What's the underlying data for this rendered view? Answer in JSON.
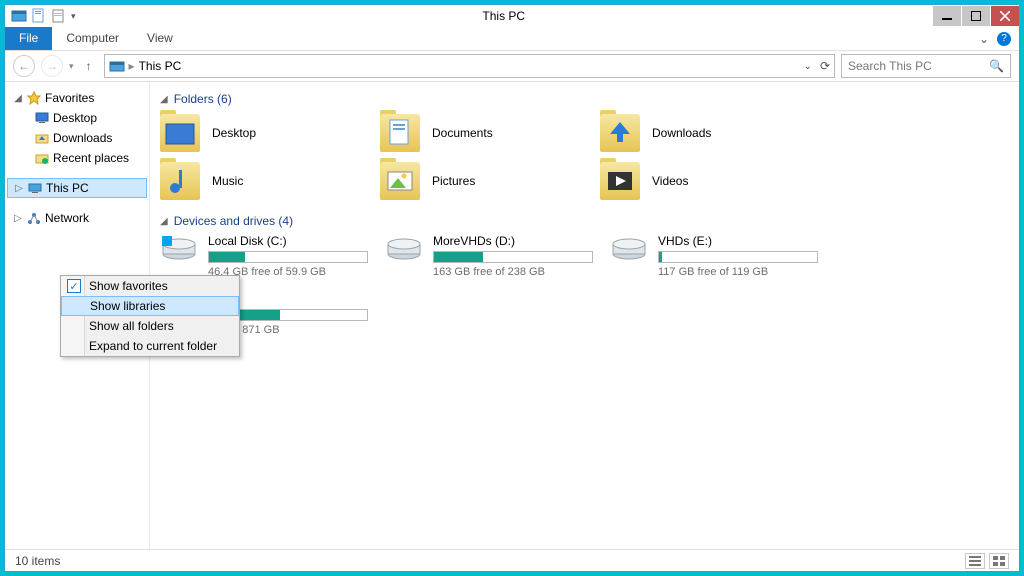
{
  "titlebar": {
    "title": "This PC"
  },
  "ribbon": {
    "file": "File",
    "tabs": [
      "Computer",
      "View"
    ]
  },
  "address": {
    "crumb": "This PC"
  },
  "search": {
    "placeholder": "Search This PC"
  },
  "nav": {
    "favorites_label": "Favorites",
    "favorites": [
      "Desktop",
      "Downloads",
      "Recent places"
    ],
    "thispc_label": "This PC",
    "network_label": "Network"
  },
  "sections": {
    "folders_title": "Folders (6)",
    "drives_title": "Devices and drives (4)"
  },
  "folders": [
    {
      "name": "Desktop"
    },
    {
      "name": "Documents"
    },
    {
      "name": "Downloads"
    },
    {
      "name": "Music"
    },
    {
      "name": "Pictures"
    },
    {
      "name": "Videos"
    }
  ],
  "drives": [
    {
      "name": "Local Disk (C:)",
      "free": "46.4 GB free of 59.9 GB",
      "fill_pct": 23
    },
    {
      "name": "MoreVHDs (D:)",
      "free": "163 GB free of 238 GB",
      "fill_pct": 31
    },
    {
      "name": "VHDs (E:)",
      "free": "117 GB free of 119 GB",
      "fill_pct": 2
    },
    {
      "name": "G:)",
      "free": "free of 871 GB",
      "fill_pct": 45
    }
  ],
  "context_menu": {
    "items": [
      {
        "label": "Show favorites",
        "checked": true,
        "hover": false
      },
      {
        "label": "Show libraries",
        "checked": false,
        "hover": true
      },
      {
        "label": "Show all folders",
        "checked": false,
        "hover": false
      },
      {
        "label": "Expand to current folder",
        "checked": false,
        "hover": false
      }
    ]
  },
  "status": {
    "count": "10 items"
  }
}
